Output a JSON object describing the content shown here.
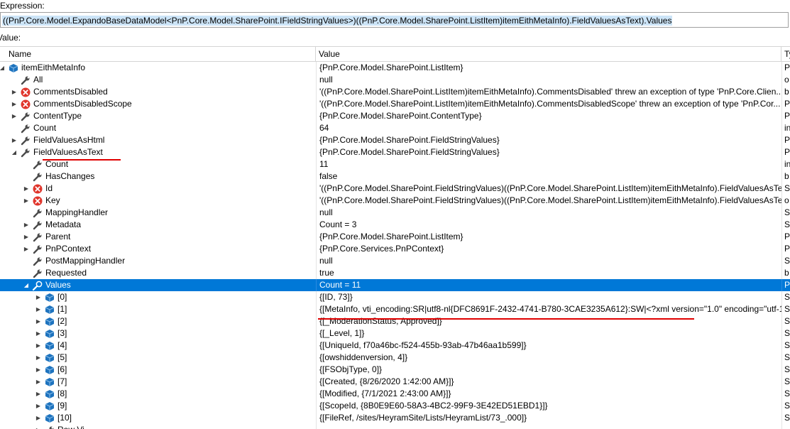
{
  "expression": {
    "label": "Expression:",
    "text": "((PnP.Core.Model.ExpandoBaseDataModel<PnP.Core.Model.SharePoint.IFieldStringValues>)((PnP.Core.Model.SharePoint.ListItem)itemEithMetaInfo).FieldValuesAsText).Values"
  },
  "value_label": "Value:",
  "columns": {
    "name": "Name",
    "value": "Value",
    "type": "Ty"
  },
  "rows": [
    {
      "depth": 0,
      "exp": "open",
      "icon": "object",
      "name": "itemEithMetaInfo",
      "value": "{PnP.Core.Model.SharePoint.ListItem}",
      "type": "P"
    },
    {
      "depth": 1,
      "exp": "none",
      "icon": "wrench",
      "name": "All",
      "value": "null",
      "type": "o"
    },
    {
      "depth": 1,
      "exp": "closed",
      "icon": "error",
      "name": "CommentsDisabled",
      "value": "'((PnP.Core.Model.SharePoint.ListItem)itemEithMetaInfo).CommentsDisabled' threw an exception of type 'PnP.Core.Clien...",
      "type": "b"
    },
    {
      "depth": 1,
      "exp": "closed",
      "icon": "error",
      "name": "CommentsDisabledScope",
      "value": "'((PnP.Core.Model.SharePoint.ListItem)itemEithMetaInfo).CommentsDisabledScope' threw an exception of type 'PnP.Cor...",
      "type": "P"
    },
    {
      "depth": 1,
      "exp": "closed",
      "icon": "wrench",
      "name": "ContentType",
      "value": "{PnP.Core.Model.SharePoint.ContentType}",
      "type": "P"
    },
    {
      "depth": 1,
      "exp": "none",
      "icon": "wrench",
      "name": "Count",
      "value": "64",
      "type": "in"
    },
    {
      "depth": 1,
      "exp": "closed",
      "icon": "wrench",
      "name": "FieldValuesAsHtml",
      "value": "{PnP.Core.Model.SharePoint.FieldStringValues}",
      "type": "P"
    },
    {
      "depth": 1,
      "exp": "open",
      "icon": "wrench",
      "name": "FieldValuesAsText",
      "value": "{PnP.Core.Model.SharePoint.FieldStringValues}",
      "type": "P"
    },
    {
      "depth": 2,
      "exp": "none",
      "icon": "wrench",
      "name": "Count",
      "value": "11",
      "type": "in"
    },
    {
      "depth": 2,
      "exp": "none",
      "icon": "wrench",
      "name": "HasChanges",
      "value": "false",
      "type": "b"
    },
    {
      "depth": 2,
      "exp": "closed",
      "icon": "error",
      "name": "Id",
      "value": "'((PnP.Core.Model.SharePoint.FieldStringValues)((PnP.Core.Model.SharePoint.ListItem)itemEithMetaInfo).FieldValuesAsTe...",
      "type": "Sy"
    },
    {
      "depth": 2,
      "exp": "closed",
      "icon": "error",
      "name": "Key",
      "value": "'((PnP.Core.Model.SharePoint.FieldStringValues)((PnP.Core.Model.SharePoint.ListItem)itemEithMetaInfo).FieldValuesAsTe...",
      "type": "o"
    },
    {
      "depth": 2,
      "exp": "none",
      "icon": "wrench",
      "name": "MappingHandler",
      "value": "null",
      "type": "Sy"
    },
    {
      "depth": 2,
      "exp": "closed",
      "icon": "wrench",
      "name": "Metadata",
      "value": "Count = 3",
      "type": "Sy"
    },
    {
      "depth": 2,
      "exp": "closed",
      "icon": "wrench",
      "name": "Parent",
      "value": "{PnP.Core.Model.SharePoint.ListItem}",
      "type": "P"
    },
    {
      "depth": 2,
      "exp": "closed",
      "icon": "wrench",
      "name": "PnPContext",
      "value": "{PnP.Core.Services.PnPContext}",
      "type": "P"
    },
    {
      "depth": 2,
      "exp": "none",
      "icon": "wrench",
      "name": "PostMappingHandler",
      "value": "null",
      "type": "Sy"
    },
    {
      "depth": 2,
      "exp": "none",
      "icon": "wrench",
      "name": "Requested",
      "value": "true",
      "type": "b"
    },
    {
      "depth": 2,
      "exp": "open",
      "icon": "wrench-search",
      "name": "Values",
      "value": "Count = 11",
      "type": "P",
      "selected": true
    },
    {
      "depth": 3,
      "exp": "closed",
      "icon": "object",
      "name": "[0]",
      "value": "{[ID, 73]}",
      "type": "Sy"
    },
    {
      "depth": 3,
      "exp": "closed",
      "icon": "object",
      "name": "[1]",
      "value": "{[MetaInfo, vti_encoding:SR|utf8-nl{DFC8691F-2432-4741-B780-3CAE3235A612}:SW|<?xml version=\"1.0\" encoding=\"utf-1...",
      "type": "Sy"
    },
    {
      "depth": 3,
      "exp": "closed",
      "icon": "object",
      "name": "[2]",
      "value": "{[_ModerationStatus, Approved]}",
      "type": "Sy"
    },
    {
      "depth": 3,
      "exp": "closed",
      "icon": "object",
      "name": "[3]",
      "value": "{[_Level, 1]}",
      "type": "Sy"
    },
    {
      "depth": 3,
      "exp": "closed",
      "icon": "object",
      "name": "[4]",
      "value": "{[UniqueId, f70a46bc-f524-455b-93ab-47b46aa1b599]}",
      "type": "Sy"
    },
    {
      "depth": 3,
      "exp": "closed",
      "icon": "object",
      "name": "[5]",
      "value": "{[owshiddenversion, 4]}",
      "type": "Sy"
    },
    {
      "depth": 3,
      "exp": "closed",
      "icon": "object",
      "name": "[6]",
      "value": "{[FSObjType, 0]}",
      "type": "Sy"
    },
    {
      "depth": 3,
      "exp": "closed",
      "icon": "object",
      "name": "[7]",
      "value": "{[Created, {8/26/2020 1:42:00 AM}]}",
      "type": "Sy"
    },
    {
      "depth": 3,
      "exp": "closed",
      "icon": "object",
      "name": "[8]",
      "value": "{[Modified, {7/1/2021 2:43:00 AM}]}",
      "type": "Sy"
    },
    {
      "depth": 3,
      "exp": "closed",
      "icon": "object",
      "name": "[9]",
      "value": "{[ScopeId, {8B0E9E60-58A3-4BC2-99F9-3E42ED51EBD1}]}",
      "type": "Sy"
    },
    {
      "depth": 3,
      "exp": "closed",
      "icon": "object",
      "name": "[10]",
      "value": "{[FileRef, /sites/HeyramSite/Lists/HeyramList/73_.000]}",
      "type": "Sy"
    },
    {
      "depth": 3,
      "exp": "closed",
      "icon": "wrench",
      "name": "Raw Vi",
      "value": "",
      "type": ""
    }
  ],
  "colors": {
    "selection": "#0078d7",
    "error": "#e0352b",
    "object": "#1e73be",
    "wrench": "#4a4a4a",
    "annotation": "#e00000"
  }
}
